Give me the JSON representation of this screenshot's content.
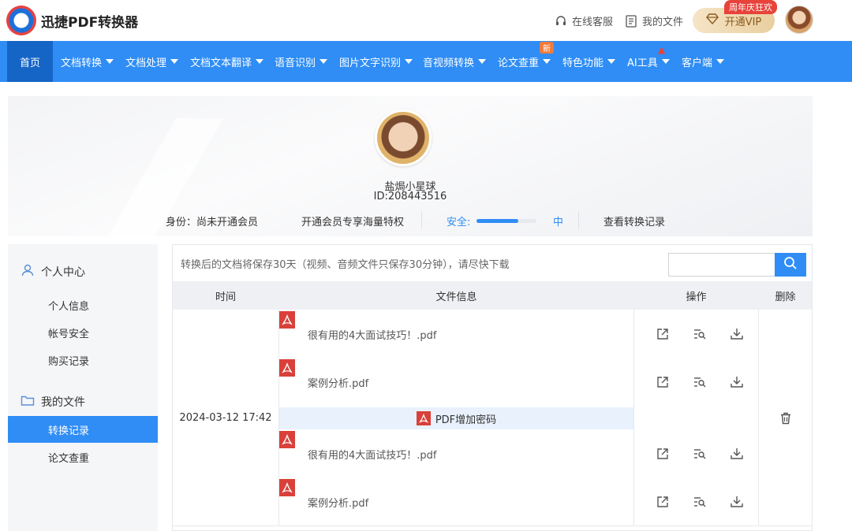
{
  "app": {
    "title": "迅捷PDF转换器"
  },
  "header": {
    "service_label": "在线客服",
    "files_label": "我的文件",
    "vip_label": "开通VIP",
    "vip_badge": "周年庆狂欢"
  },
  "nav": {
    "items": [
      {
        "label": "首页"
      },
      {
        "label": "文档转换"
      },
      {
        "label": "文档处理"
      },
      {
        "label": "文档文本翻译"
      },
      {
        "label": "语音识别"
      },
      {
        "label": "图片文字识别"
      },
      {
        "label": "音视频转换"
      },
      {
        "label": "论文查重"
      },
      {
        "label": "特色功能"
      },
      {
        "label": "AI工具"
      },
      {
        "label": "客户端"
      }
    ],
    "new_badge": "新"
  },
  "profile": {
    "username": "盐焗小星球",
    "user_id": "ID:208443516",
    "identity": "身份：尚未开通会员",
    "vip_promo": "开通会员专享海量特权",
    "security_label": "安全:",
    "security_level": 0.7,
    "security_text": "中",
    "history_link": "查看转换记录"
  },
  "sidebar": {
    "groups": [
      {
        "label": "个人中心",
        "icon": "user-icon",
        "items": [
          {
            "label": "个人信息"
          },
          {
            "label": "帐号安全"
          },
          {
            "label": "购买记录"
          }
        ]
      },
      {
        "label": "我的文件",
        "icon": "folder-icon",
        "items": [
          {
            "label": "转换记录"
          },
          {
            "label": "论文查重"
          }
        ]
      }
    ]
  },
  "main": {
    "notice": "转换后的文档将保存30天（视频、音频文件只保存30分钟），请尽快下载",
    "search_placeholder": "",
    "columns": {
      "time": "时间",
      "file_info": "文件信息",
      "actions": "操作",
      "delete": "删除"
    },
    "record": {
      "time": "2024-03-12 17:42",
      "task_label": "PDF增加密码",
      "input_files": [
        {
          "name": "很有用的4大面试技巧！.pdf"
        },
        {
          "name": "案例分析.pdf"
        }
      ],
      "output_files": [
        {
          "name": "很有用的4大面试技巧！.pdf"
        },
        {
          "name": "案例分析.pdf"
        }
      ]
    }
  },
  "colors": {
    "primary": "#2f8df5",
    "nav_active": "#1565c7",
    "pdf_red": "#d9403a",
    "vip_gold": "#e9cf9f"
  }
}
